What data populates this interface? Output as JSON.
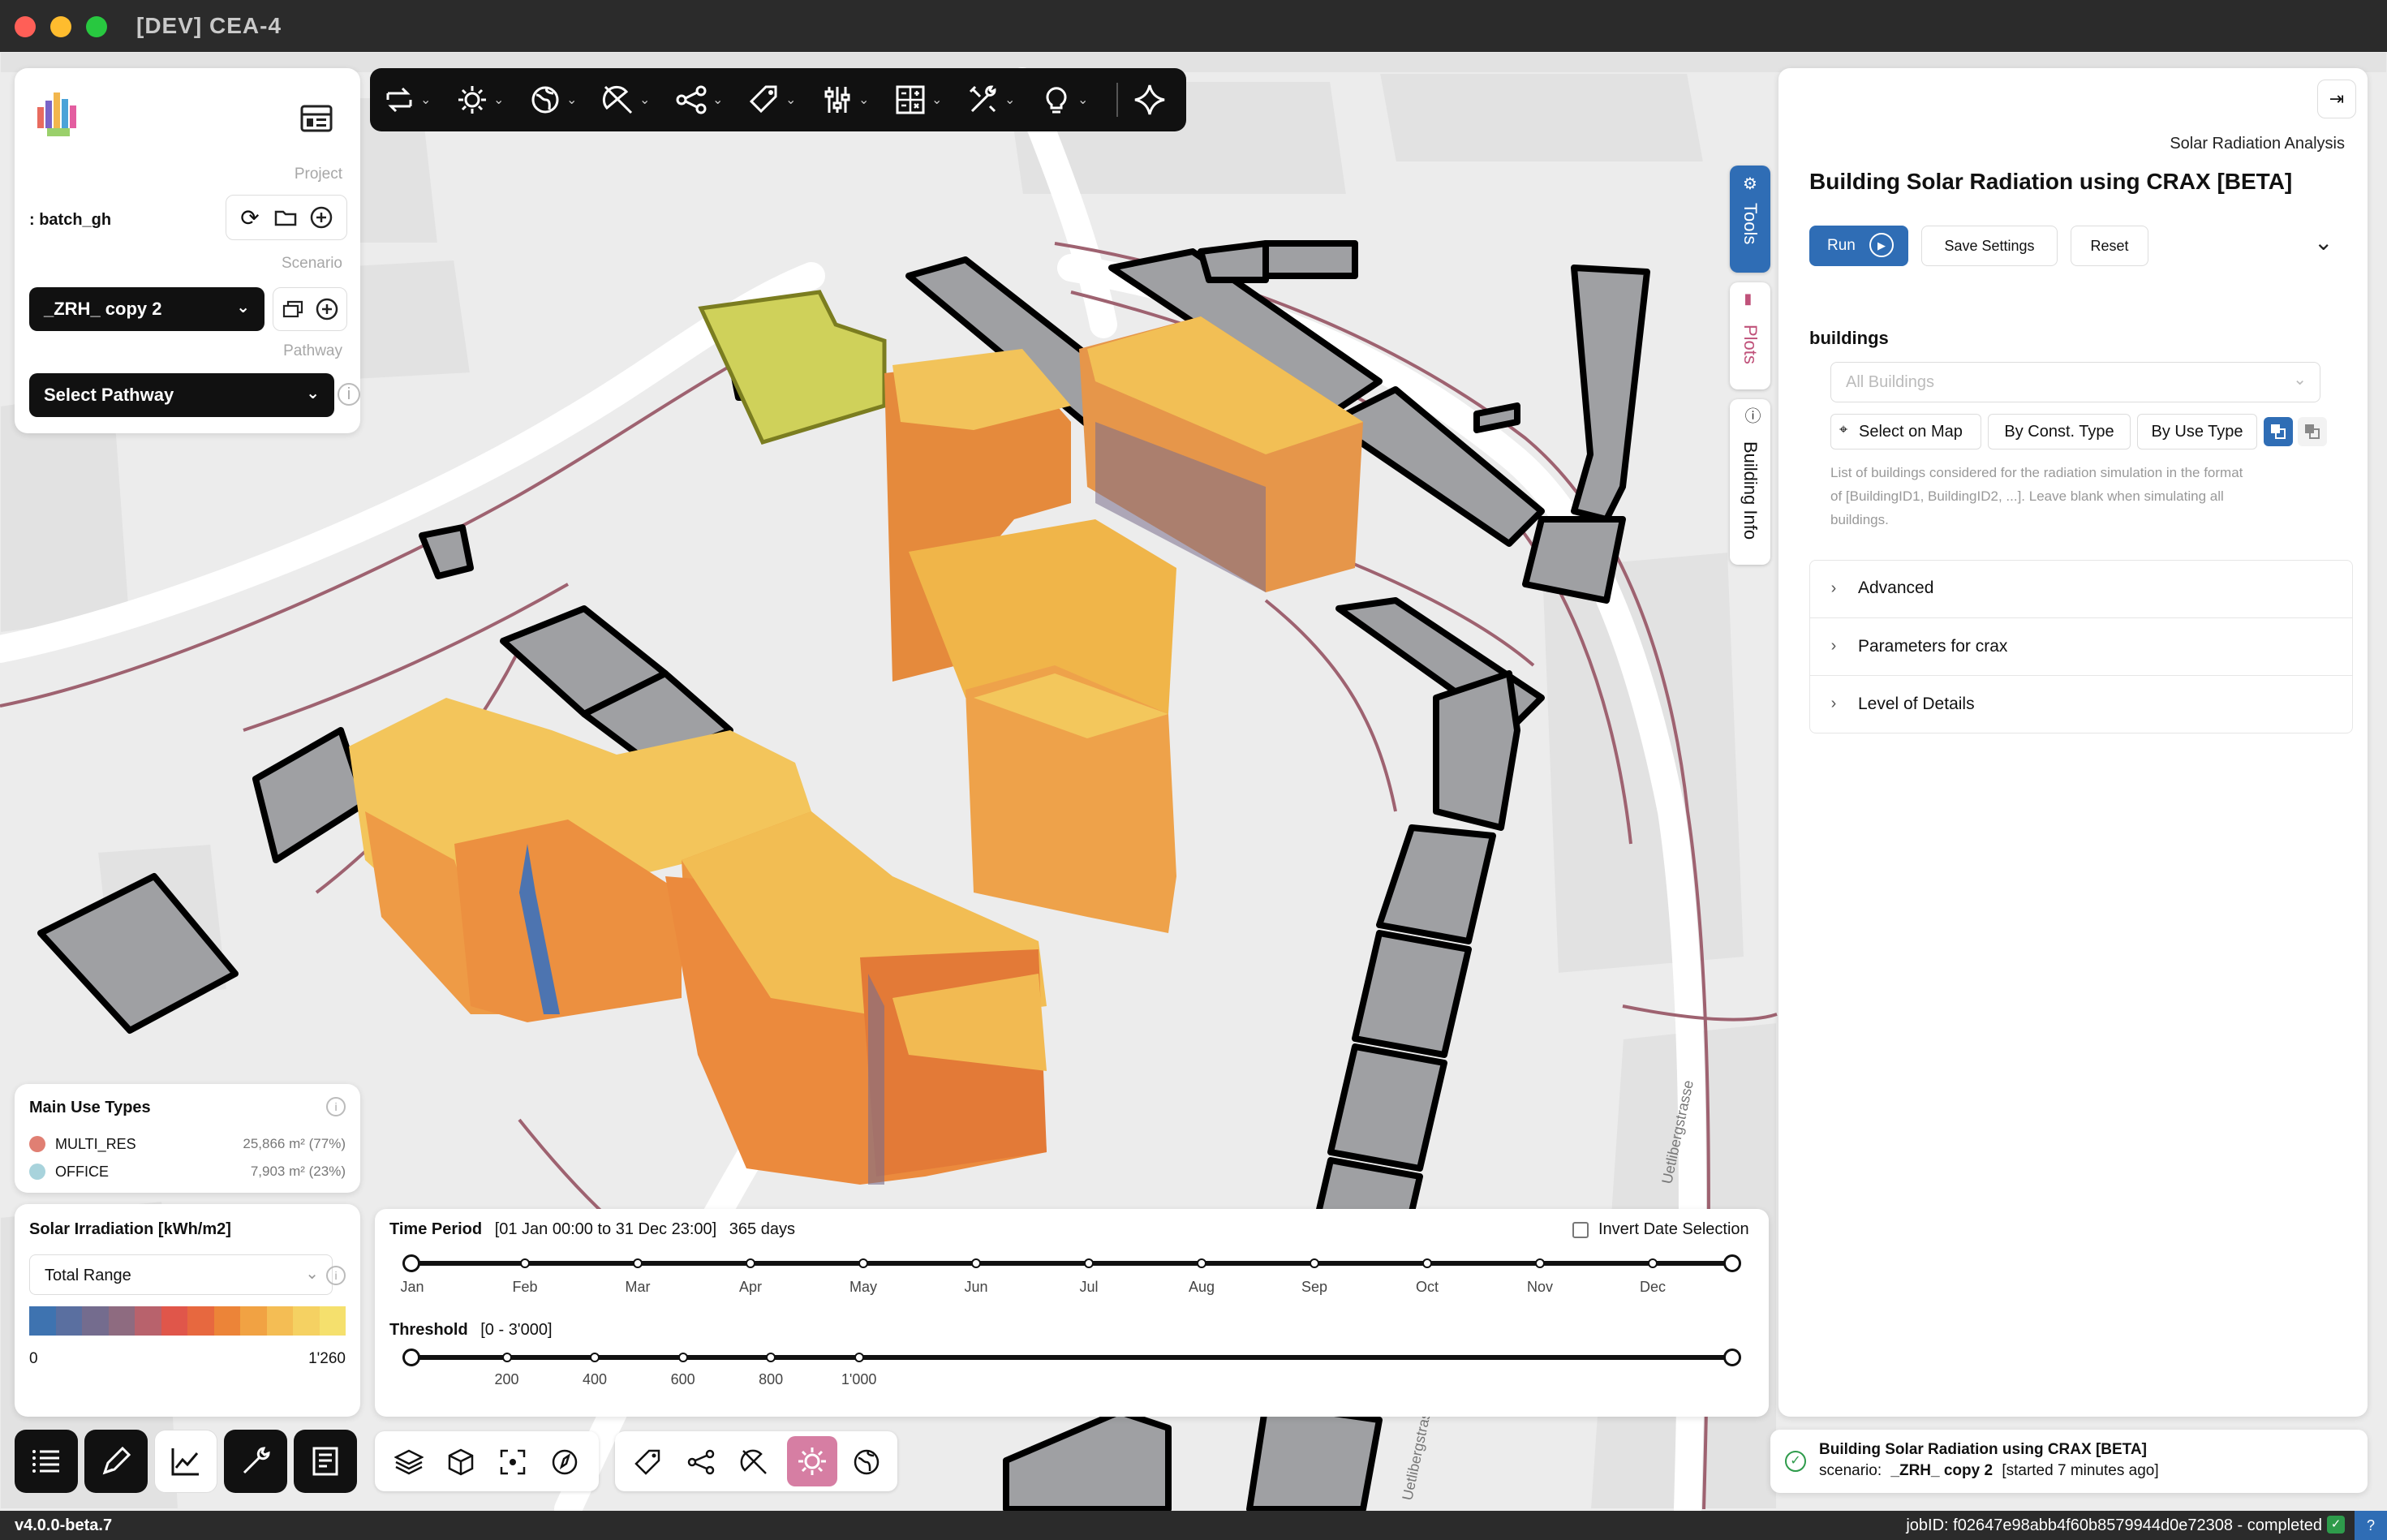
{
  "window": {
    "title": "[DEV] CEA-4"
  },
  "left_panel": {
    "project_label": "Project",
    "project_name": ": batch_gh",
    "scenario_label": "Scenario",
    "scenario_value": "_ZRH_ copy 2",
    "pathway_label": "Pathway",
    "pathway_value": "Select Pathway"
  },
  "legend": {
    "title": "Main Use Types",
    "items": [
      {
        "name": "MULTI_RES",
        "value": "25,866 m² (77%)",
        "color": "#e07f73"
      },
      {
        "name": "OFFICE",
        "value": "7,903 m² (23%)",
        "color": "#a8d3dc"
      }
    ]
  },
  "irradiation": {
    "title": "Solar Irradiation [kWh/m2]",
    "select_value": "Total Range",
    "min": "0",
    "max": "1'260",
    "colors": [
      "#3e73b0",
      "#5a6fa0",
      "#746c8e",
      "#8e6b80",
      "#b8626c",
      "#e0564a",
      "#e7683f",
      "#ec8438",
      "#f1a243",
      "#f4bd54",
      "#f5d162",
      "#f5e06d"
    ]
  },
  "time_period": {
    "label": "Time Period",
    "range": "[01 Jan 00:00 to 31 Dec 23:00]",
    "days": "365 days",
    "invert_label": "Invert Date Selection",
    "months": [
      "Jan",
      "Feb",
      "Mar",
      "Apr",
      "May",
      "Jun",
      "Jul",
      "Aug",
      "Sep",
      "Oct",
      "Nov",
      "Dec"
    ]
  },
  "threshold": {
    "label": "Threshold",
    "range": "[0 - 3'000]",
    "ticks": [
      "200",
      "400",
      "600",
      "800",
      "1'000"
    ]
  },
  "right_panel": {
    "section": "Solar Radiation Analysis",
    "title": "Building Solar Radiation using CRAX [BETA]",
    "run": "Run",
    "save": "Save Settings",
    "reset": "Reset",
    "buildings_label": "buildings",
    "buildings_placeholder": "All Buildings",
    "select_on_map": "Select on Map",
    "by_const": "By Const. Type",
    "by_use": "By Use Type",
    "help_line1": "List of buildings considered for the radiation simulation in the format",
    "help_line2": "of [BuildingID1, BuildingID2, ...]. Leave blank when simulating all",
    "help_line3": "buildings.",
    "accordions": [
      "Advanced",
      "Parameters for crax",
      "Level of Details"
    ]
  },
  "side_tabs": [
    "Tools",
    "Plots",
    "Building Info"
  ],
  "job": {
    "title": "Building Solar Radiation using CRAX [BETA]",
    "scenario_prefix": "scenario:",
    "scenario": "_ZRH_ copy 2",
    "started": "[started 7 minutes ago]"
  },
  "status_bar": {
    "version": "v4.0.0-beta.7",
    "job_id": "jobID: f02647e98abb4f60b8579944d0e72308 - completed"
  },
  "map_labels": [
    "Uetlibergstrasse",
    "Uetlibergstras"
  ],
  "colors": {
    "accent": "#2f6db5",
    "highlight": "#cfd15a",
    "dark": "#111111"
  }
}
